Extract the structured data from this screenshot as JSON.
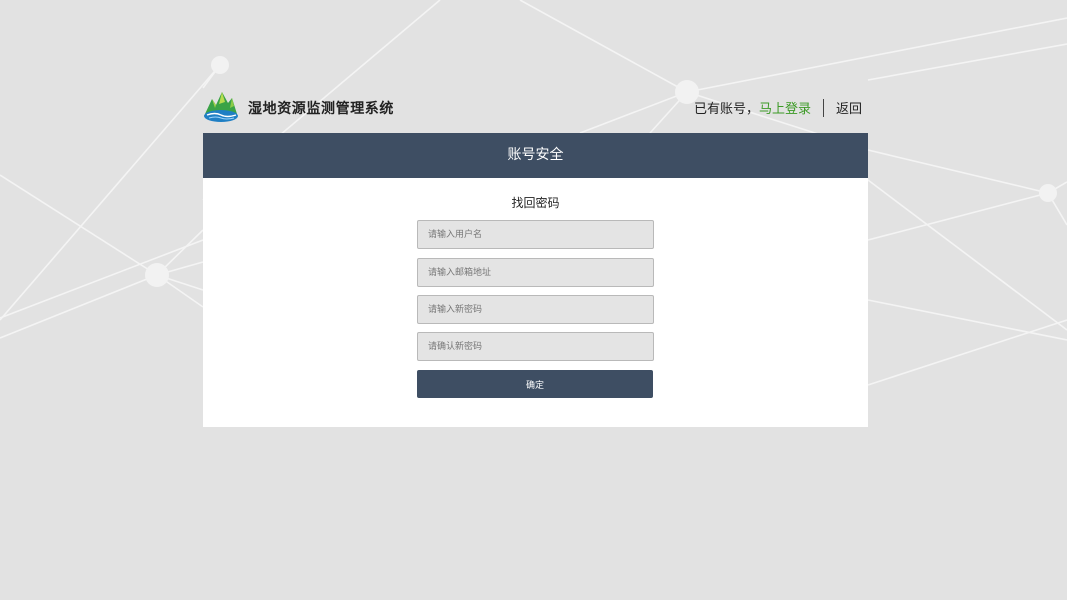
{
  "header": {
    "site_title": "湿地资源监测管理系统",
    "have_account_text": "已有账号，",
    "login_link": "马上登录",
    "back_link": "返回"
  },
  "panel": {
    "title": "账号安全"
  },
  "form": {
    "title": "找回密码",
    "username_placeholder": "请输入用户名",
    "email_placeholder": "请输入邮箱地址",
    "new_password_placeholder": "请输入新密码",
    "confirm_password_placeholder": "请确认新密码",
    "submit_label": "确定"
  },
  "colors": {
    "primary": "#3e4e63",
    "link_green": "#3c9a26",
    "background": "#e2e2e2"
  },
  "icons": {
    "logo": "wetland-mountain-logo-icon"
  }
}
